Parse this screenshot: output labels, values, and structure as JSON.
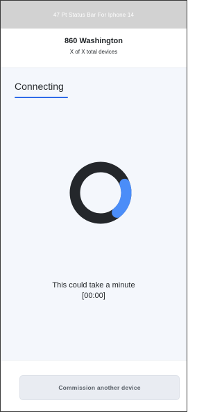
{
  "status_bar": {
    "label": "47 Pt Status Bar For Iphone 14"
  },
  "header": {
    "title": "860 Washington",
    "subtitle": "X of X total devices"
  },
  "tabs": [
    {
      "label": "Connecting",
      "active": true
    }
  ],
  "spinner": {
    "progress": 0.25,
    "track_color": "#24272b",
    "progress_color": "#4b8df8"
  },
  "message": {
    "line1": "This could take a minute",
    "timer": "[00:00]"
  },
  "footer": {
    "button_label": "Commission another device"
  },
  "colors": {
    "accent": "#2f6be8",
    "content_bg": "#f4f7fc"
  }
}
